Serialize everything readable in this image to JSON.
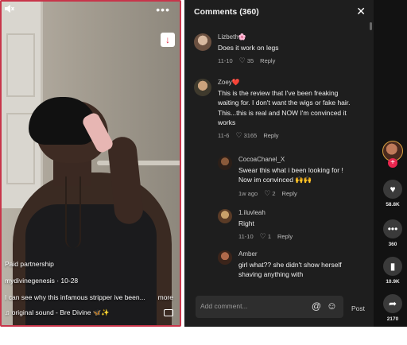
{
  "video": {
    "paid_label": "Paid partnership",
    "author": "mydivinegenesis",
    "date": "10-28",
    "description": "I can see why this infamous stripper ive been...",
    "more_label": "more",
    "sound": "original sound - Bre Divine 🦋✨"
  },
  "comments_panel": {
    "title": "Comments",
    "count": "(360)",
    "close_label": "✕",
    "input_placeholder": "Add comment...",
    "post_label": "Post",
    "comments": [
      {
        "name": "Lizbeth🌸",
        "text": "Does it work on legs",
        "date": "11-10",
        "likes": "35",
        "reply": "Reply"
      },
      {
        "name": "Zoey❤️",
        "text": "This is the review that I've been freaking waiting for. I don't want the wigs or fake hair. This...this is real and NOW I'm convinced it works",
        "date": "11-6",
        "likes": "3165",
        "reply": "Reply"
      },
      {
        "name": "CocoaChanel_X",
        "text": "Swear this what i been looking for ! Now im convinced 🙌🙌",
        "date": "1w ago",
        "likes": "2",
        "reply": "Reply"
      },
      {
        "name": "1.iluvleah",
        "text": "Right",
        "date": "11-10",
        "likes": "1",
        "reply": "Reply"
      },
      {
        "name": "Amber",
        "text": "girl what?? she didn't show herself shaving anything with",
        "date": "",
        "likes": "",
        "reply": ""
      }
    ]
  },
  "actions": {
    "likes": "58.8K",
    "comments": "360",
    "saves": "10.9K",
    "shares": "2170"
  },
  "colors": {
    "accent": "#e9264f",
    "panel_bg": "#1e1e1e",
    "video_border": "#c8354a"
  }
}
